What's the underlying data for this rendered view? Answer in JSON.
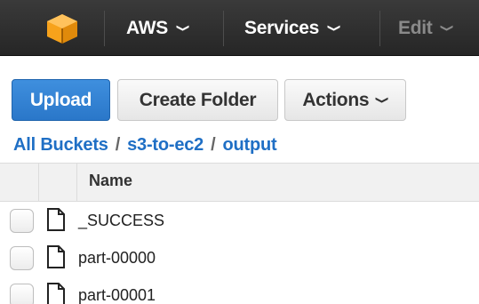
{
  "topbar": {
    "logo_icon": "aws-cube-icon",
    "brand_color": "#f7a21b",
    "items": [
      {
        "label": "AWS",
        "icon": "chevron-down-icon"
      },
      {
        "label": "Services",
        "icon": "chevron-down-icon"
      },
      {
        "label": "Edit",
        "icon": "chevron-down-icon"
      }
    ]
  },
  "toolbar": {
    "upload_label": "Upload",
    "create_folder_label": "Create Folder",
    "actions_label": "Actions",
    "primary_color": "#2a77c9"
  },
  "breadcrumb": {
    "items": [
      "All Buckets",
      "s3-to-ec2",
      "output"
    ],
    "separator": "/"
  },
  "table": {
    "columns": [
      "Name"
    ],
    "rows": [
      {
        "name": "_SUCCESS",
        "icon": "file-icon"
      },
      {
        "name": "part-00000",
        "icon": "file-icon"
      },
      {
        "name": "part-00001",
        "icon": "file-icon"
      }
    ]
  }
}
